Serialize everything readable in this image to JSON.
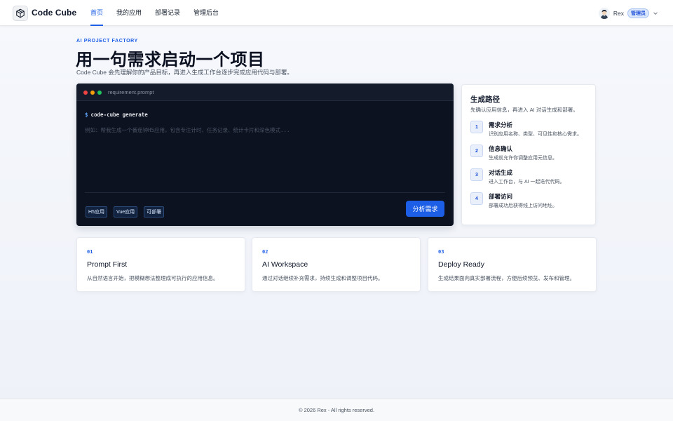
{
  "header": {
    "brand": "Code Cube",
    "logo_icon": "cube-icon",
    "nav": [
      {
        "label": "首页",
        "active": true
      },
      {
        "label": "我的应用",
        "active": false
      },
      {
        "label": "部署记录",
        "active": false
      },
      {
        "label": "管理后台",
        "active": false
      }
    ],
    "user": {
      "name": "Rex",
      "role": "管理员",
      "avatar_icon": "avatar-icon",
      "menu_icon": "chevron-down-icon"
    }
  },
  "hero": {
    "kicker": "AI PROJECT FACTORY",
    "title": "用一句需求启动一个项目",
    "subtitle": "Code Cube 会先理解你的产品目标，再进入生成工作台逐步完成应用代码与部署。"
  },
  "terminal": {
    "filename": "requirement.prompt",
    "prompt_symbol": "$",
    "command": "code-cube generate",
    "placeholder": "例如：帮我生成一个番茄钟H5应用，包含专注计时、任务记录、统计卡片和深色模式...",
    "value": "",
    "tags": [
      "H5应用",
      "Vue应用",
      "可部署"
    ],
    "submit_label": "分析需求",
    "accent": "#1d5ee6"
  },
  "path": {
    "title": "生成路径",
    "subtitle": "先确认应用信息，再进入 AI 对话生成和部署。",
    "steps": [
      {
        "num": "1",
        "title": "需求分析",
        "desc": "识别应用名称、类型、可见性和核心需求。"
      },
      {
        "num": "2",
        "title": "信息确认",
        "desc": "生成前允许你调整应用元信息。"
      },
      {
        "num": "3",
        "title": "对话生成",
        "desc": "进入工作台，与 AI 一起迭代代码。"
      },
      {
        "num": "4",
        "title": "部署访问",
        "desc": "部署成功后获得线上访问地址。"
      }
    ]
  },
  "features": [
    {
      "num": "01",
      "title": "Prompt First",
      "desc": "从自然语言开始，把模糊想法整理成可执行的应用信息。"
    },
    {
      "num": "02",
      "title": "AI Workspace",
      "desc": "通过对话继续补充需求，持续生成和调整项目代码。"
    },
    {
      "num": "03",
      "title": "Deploy Ready",
      "desc": "生成结果面向真实部署流程，方便后续预览、发布和管理。"
    }
  ],
  "footer": {
    "text": "© 2026 Rex - All rights reserved."
  }
}
